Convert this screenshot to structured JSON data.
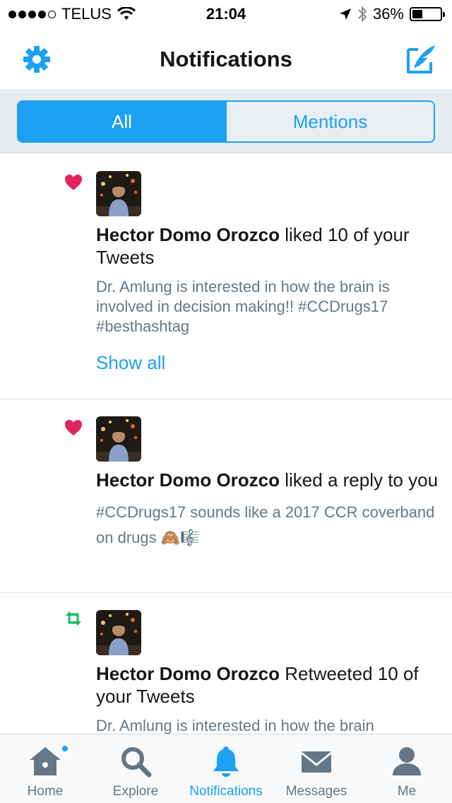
{
  "status_bar": {
    "carrier": "TELUS",
    "time": "21:04",
    "battery_percent": "36%",
    "battery_level": 0.36,
    "signal_bars_filled": 4,
    "signal_bars_total": 5
  },
  "header": {
    "title": "Notifications",
    "settings_icon": "gear-icon",
    "compose_icon": "compose-icon"
  },
  "segments": {
    "all_label": "All",
    "mentions_label": "Mentions",
    "selected": "All"
  },
  "notifications": [
    {
      "kind": "like",
      "kind_icon": "heart-icon",
      "user": "Hector Domo Orozco",
      "action": " liked 10 of your Tweets",
      "text": "Dr. Amlung is interested in how the brain is involved in decision making!! #CCDrugs17 #besthashtag",
      "link": "Show all"
    },
    {
      "kind": "like",
      "kind_icon": "heart-icon",
      "user": "Hector Domo Orozco",
      "action": " liked a reply to you",
      "text": "#CCDrugs17 sounds like a 2017 CCR coverband on drugs 🙈🎼"
    },
    {
      "kind": "retweet",
      "kind_icon": "retweet-icon",
      "user": "Hector Domo Orozco",
      "action": " Retweeted 10 of your Tweets",
      "text": "Dr. Amlung is interested in how the brain"
    }
  ],
  "tabs": [
    {
      "label": "Home",
      "icon": "home-icon"
    },
    {
      "label": "Explore",
      "icon": "search-icon"
    },
    {
      "label": "Notifications",
      "icon": "bell-icon"
    },
    {
      "label": "Messages",
      "icon": "envelope-icon"
    },
    {
      "label": "Me",
      "icon": "person-icon"
    }
  ],
  "colors": {
    "accent": "#1da1f2",
    "like": "#e0245e",
    "retweet": "#17bf63",
    "secondary_text": "#657786"
  }
}
